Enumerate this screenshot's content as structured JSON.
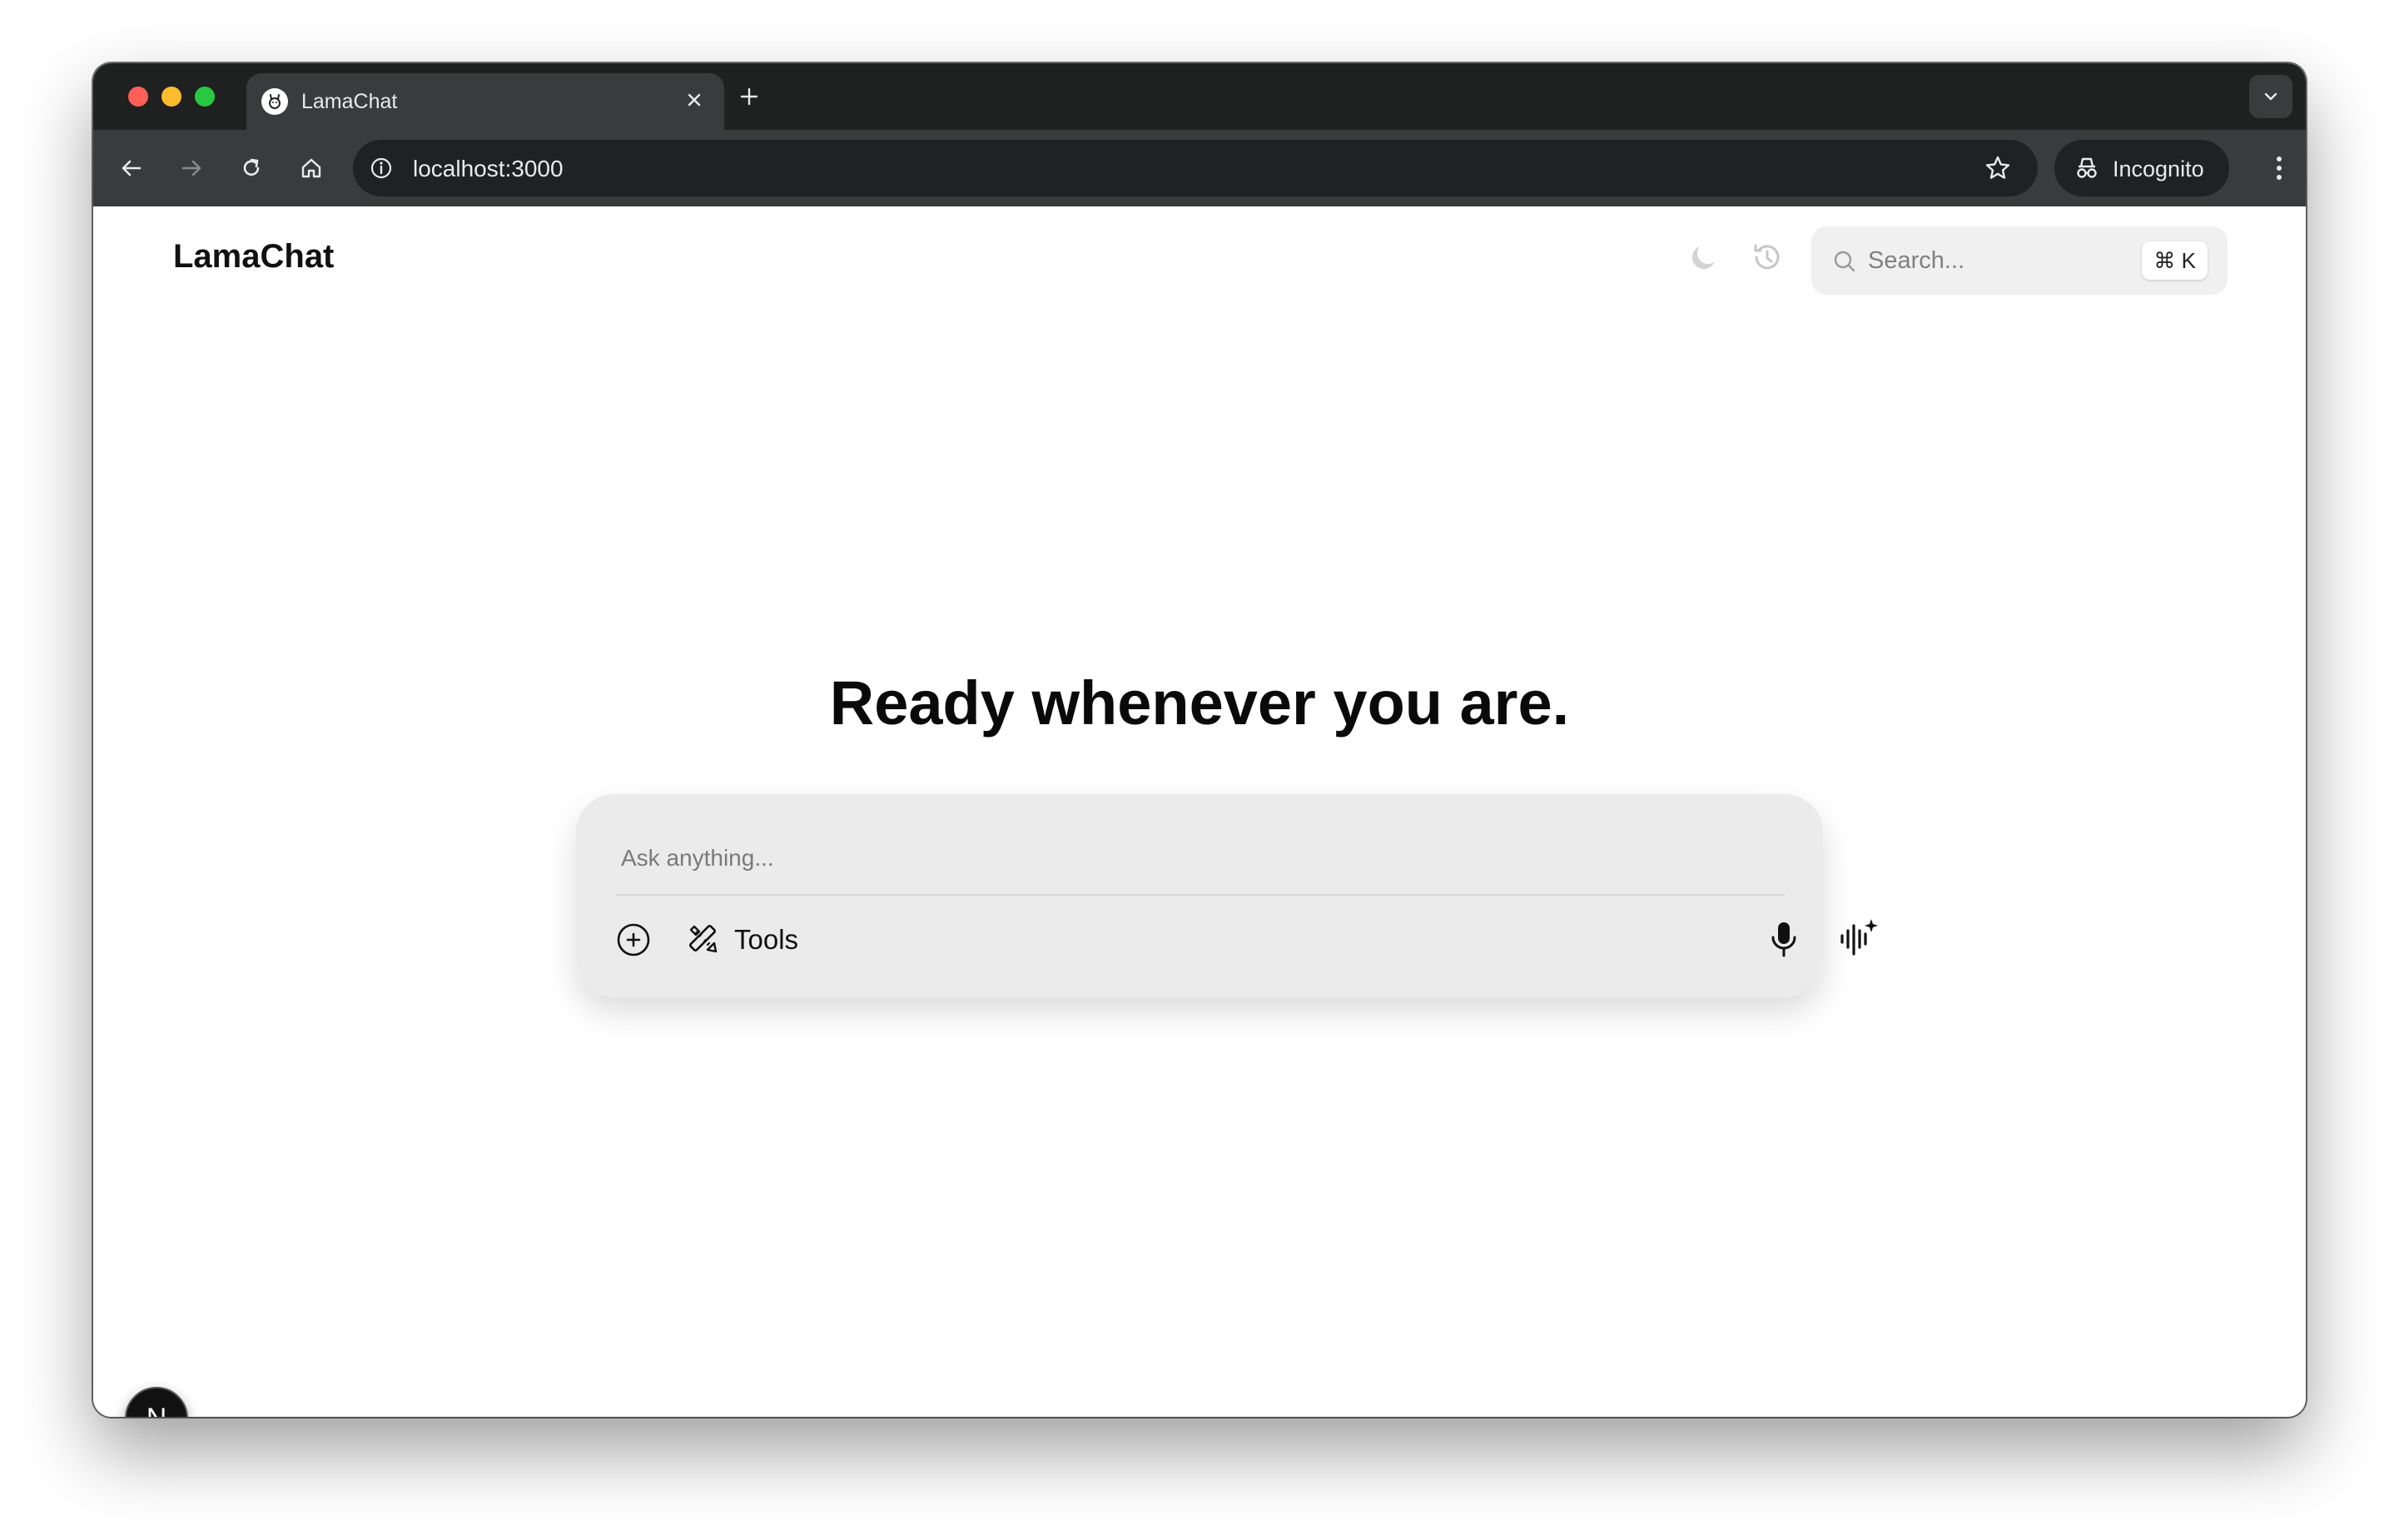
{
  "browser": {
    "tab_title": "LamaChat",
    "url": "localhost:3000",
    "incognito_label": "Incognito"
  },
  "app": {
    "logo": "LamaChat",
    "search_placeholder": "Search...",
    "search_shortcut": "⌘ K"
  },
  "main": {
    "headline": "Ready whenever you are.",
    "composer": {
      "placeholder": "Ask anything...",
      "tools_label": "Tools"
    }
  },
  "badge": {
    "letter": "N"
  },
  "icons": {
    "tab_favicon": "llama-icon",
    "theme": "moon-icon",
    "history": "history-icon",
    "search": "search-icon",
    "attach": "plus-circle-icon",
    "tools": "tools-icon",
    "mic": "microphone-icon",
    "voice": "voice-mode-icon"
  },
  "colors": {
    "tab_bar": "#1f2020",
    "toolbar": "#3a3b3c",
    "composer_bg": "#ebebeb",
    "text_primary": "#0a0a0a"
  }
}
